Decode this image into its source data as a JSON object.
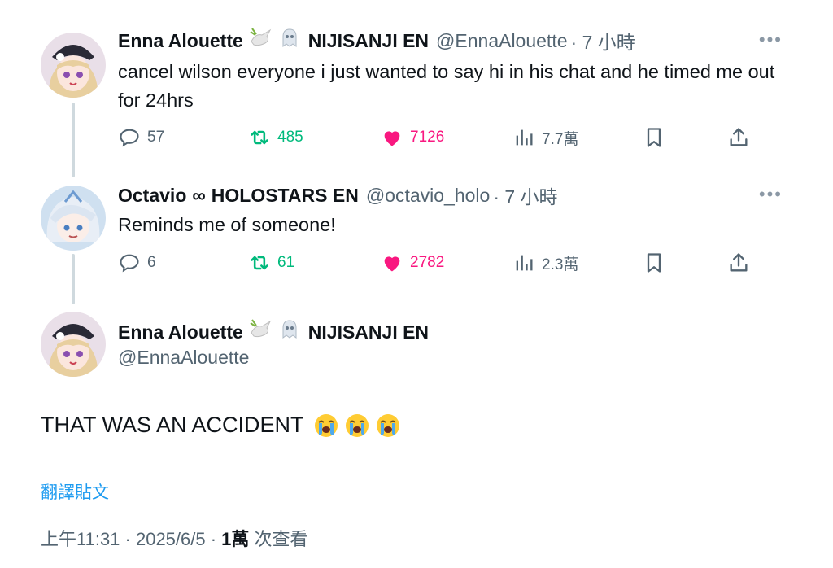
{
  "reply1": {
    "name": "Enna Alouette",
    "org": "NIJISANJI EN",
    "handle": "@EnnaAlouette",
    "time": "· 7 小時",
    "text": "cancel wilson everyone i just wanted to say hi in his chat and he timed me out for 24hrs",
    "replies": "57",
    "retweets": "485",
    "likes": "7126",
    "views": "7.7萬"
  },
  "reply2": {
    "name": "Octavio",
    "infinity": "∞",
    "org": "HOLOSTARS EN",
    "handle": "@octavio_holo",
    "time": "· 7 小時",
    "text": "Reminds me of someone!",
    "replies": "6",
    "retweets": "61",
    "likes": "2782",
    "views": "2.3萬"
  },
  "main": {
    "name": "Enna Alouette",
    "org": "NIJISANJI EN",
    "handle": "@EnnaAlouette",
    "text": "THAT WAS AN ACCIDENT",
    "translate": "翻譯貼文",
    "timestamp": "上午11:31 · 2025/6/5 · ",
    "views_count": "1萬",
    "views_label": " 次查看"
  },
  "icons": {
    "reply": "reply-icon",
    "retweet": "retweet-icon",
    "like": "heart-icon",
    "views": "views-icon",
    "bookmark": "bookmark-icon",
    "share": "share-icon",
    "more": "more-icon",
    "dove": "dove-badge-icon",
    "ghost": "ghost-badge-icon",
    "crying": "loudly-crying-face-emoji"
  },
  "colors": {
    "retweet": "#00ba7c",
    "like": "#f91880",
    "link": "#1d9bf0",
    "secondary": "#536471"
  }
}
